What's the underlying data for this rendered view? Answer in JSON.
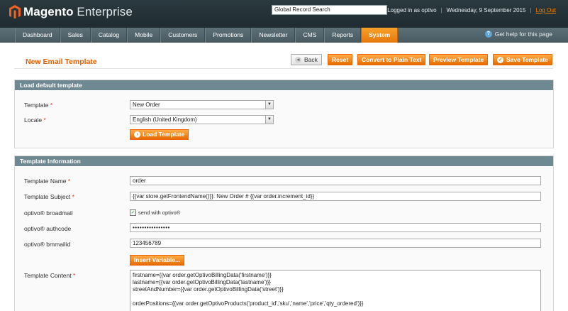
{
  "header": {
    "brand_bold": "Magento",
    "brand_light": "Enterprise",
    "search_value": "Global Record Search",
    "logged_in": "Logged in as optivo",
    "date": "Wednesday, 9 September 2015",
    "logout": "Log Out"
  },
  "nav": {
    "items": [
      "Dashboard",
      "Sales",
      "Catalog",
      "Mobile",
      "Customers",
      "Promotions",
      "Newsletter",
      "CMS",
      "Reports",
      "System"
    ],
    "active": "System",
    "help": "Get help for this page"
  },
  "page": {
    "title": "New Email Template",
    "buttons": {
      "back": "Back",
      "reset": "Reset",
      "convert": "Convert to Plain Text",
      "preview": "Preview Template",
      "save": "Save Template"
    }
  },
  "load_section": {
    "heading": "Load default template",
    "template_label": "Template",
    "template_value": "New Order",
    "locale_label": "Locale",
    "locale_value": "English (United Kingdom)",
    "load_button": "Load Template"
  },
  "info_section": {
    "heading": "Template Information",
    "name_label": "Template Name",
    "name_value": "order",
    "subject_label": "Template Subject",
    "subject_value": "{{var store.getFrontendName()}}: New Order # {{var order.increment_id}}",
    "broadmail_label": "optivo® broadmail",
    "broadmail_checkbox": "send with optivo®",
    "broadmail_checked": true,
    "authcode_label": "optivo® authcode",
    "authcode_value": "••••••••••••••••",
    "bmmailid_label": "optivo® bmmailid",
    "bmmailid_value": "123456789",
    "insert_variable": "Insert Variable...",
    "content_label": "Template Content",
    "content_lines": [
      "firstname={{var order.getOptivoBillingData('firstname')}}",
      "lastname={{var order.getOptivoBillingData('lastname')}}",
      "streetAndNumber={{var order.getOptivoBillingData('street')}}",
      "",
      "orderPositions={{var order.getOptivoProducts('product_id','sku','name','price','qty_ordered')}}"
    ]
  },
  "colors": {
    "accent": "#eb5e00",
    "section_header": "#6f8992",
    "header_bg": "#263238"
  }
}
